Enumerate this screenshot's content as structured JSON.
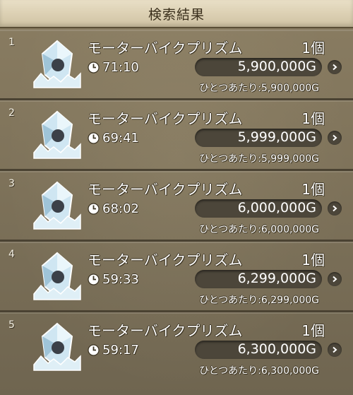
{
  "header": {
    "title": "検索結果"
  },
  "results": [
    {
      "index": "1",
      "name": "モーターバイクプリズム",
      "quantity": "1個",
      "time_left": "71:10",
      "price": "5,900,000G",
      "unit_price": "ひとつあたり:5,900,000G",
      "icon": "prism-crystal-icon"
    },
    {
      "index": "2",
      "name": "モーターバイクプリズム",
      "quantity": "1個",
      "time_left": "69:41",
      "price": "5,999,000G",
      "unit_price": "ひとつあたり:5,999,000G",
      "icon": "prism-crystal-icon"
    },
    {
      "index": "3",
      "name": "モーターバイクプリズム",
      "quantity": "1個",
      "time_left": "68:02",
      "price": "6,000,000G",
      "unit_price": "ひとつあたり:6,000,000G",
      "icon": "prism-crystal-icon"
    },
    {
      "index": "4",
      "name": "モーターバイクプリズム",
      "quantity": "1個",
      "time_left": "59:33",
      "price": "6,299,000G",
      "unit_price": "ひとつあたり:6,299,000G",
      "icon": "prism-crystal-icon"
    },
    {
      "index": "5",
      "name": "モーターバイクプリズム",
      "quantity": "1個",
      "time_left": "59:17",
      "price": "6,300,000G",
      "unit_price": "ひとつあたり:6,300,000G",
      "icon": "prism-crystal-icon"
    }
  ],
  "colors": {
    "panel": "#7a6f57",
    "price_bar": "#4c463a",
    "title_bar": "#e1d6ba"
  }
}
